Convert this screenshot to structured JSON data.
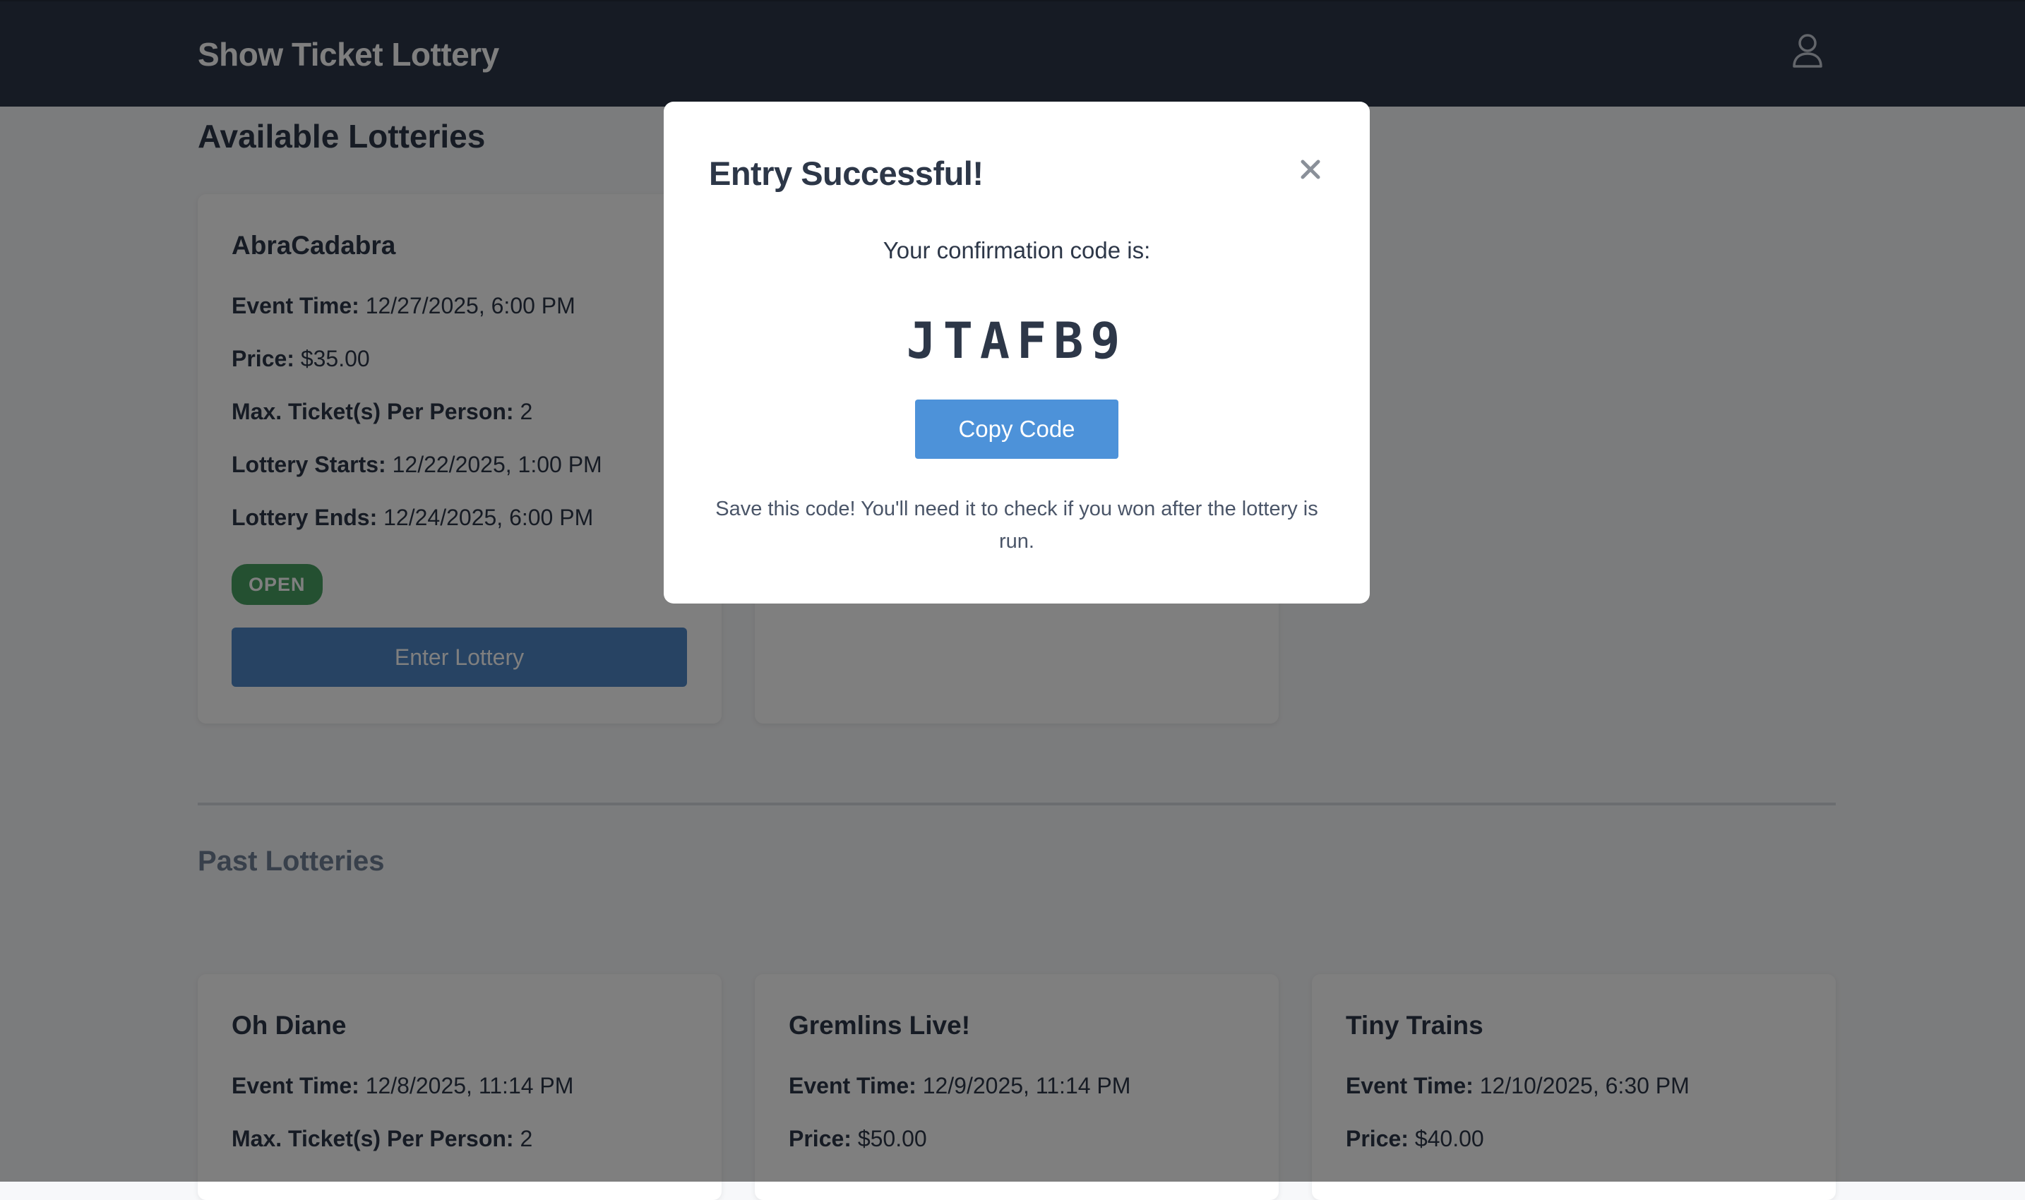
{
  "app": {
    "title": "Show Ticket Lottery",
    "user_icon": "user-icon"
  },
  "available": {
    "title": "Available Lotteries",
    "cards": [
      {
        "name": "AbraCadabra",
        "rows": [
          {
            "label": "Event Time:",
            "value": "12/27/2025, 6:00 PM"
          },
          {
            "label": "Price:",
            "value": "$35.00"
          },
          {
            "label": "Max. Ticket(s) Per Person:",
            "value": "2"
          },
          {
            "label": "Lottery Starts:",
            "value": "12/22/2025, 1:00 PM"
          },
          {
            "label": "Lottery Ends:",
            "value": "12/24/2025, 6:00 PM"
          }
        ],
        "status": "OPEN",
        "button": "Enter Lottery"
      }
    ]
  },
  "past": {
    "title": "Past Lotteries",
    "cards": [
      {
        "name": "Oh Diane",
        "rows": [
          {
            "label": "Event Time:",
            "value": "12/8/2025, 11:14 PM"
          },
          {
            "label": "Max. Ticket(s) Per Person:",
            "value": "2"
          }
        ]
      },
      {
        "name": "Gremlins Live!",
        "rows": [
          {
            "label": "Event Time:",
            "value": "12/9/2025, 11:14 PM"
          },
          {
            "label": "Price:",
            "value": "$50.00"
          }
        ]
      },
      {
        "name": "Tiny Trains",
        "rows": [
          {
            "label": "Event Time:",
            "value": "12/10/2025, 6:30 PM"
          },
          {
            "label": "Price:",
            "value": "$40.00"
          }
        ]
      }
    ]
  },
  "modal": {
    "title": "Entry Successful!",
    "close_icon": "close-icon",
    "subtitle": "Your confirmation code is:",
    "code": "JTAFB9",
    "copy_button": "Copy Code",
    "note": "Save this code! You'll need it to check if you won after the lottery is run."
  },
  "colors": {
    "header": "#2d3748",
    "primary_button": "#4f87c7",
    "open_badge": "#48a163",
    "overlay": "rgba(0,0,0,0.5)"
  }
}
